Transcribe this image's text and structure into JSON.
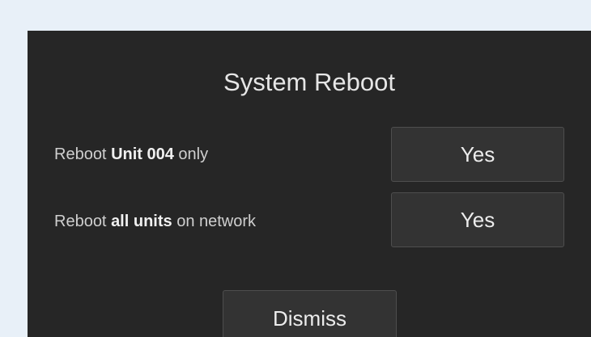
{
  "dialog": {
    "title": "System Reboot",
    "options": [
      {
        "label_prefix": "Reboot ",
        "label_bold": "Unit 004",
        "label_suffix": " only",
        "button_label": "Yes"
      },
      {
        "label_prefix": "Reboot ",
        "label_bold": "all units",
        "label_suffix": " on network",
        "button_label": "Yes"
      }
    ],
    "dismiss_label": "Dismiss"
  },
  "colors": {
    "page_background": "#e8f0f8",
    "dialog_background": "#262626",
    "button_background": "#333333",
    "button_border": "#4e4e4e"
  }
}
